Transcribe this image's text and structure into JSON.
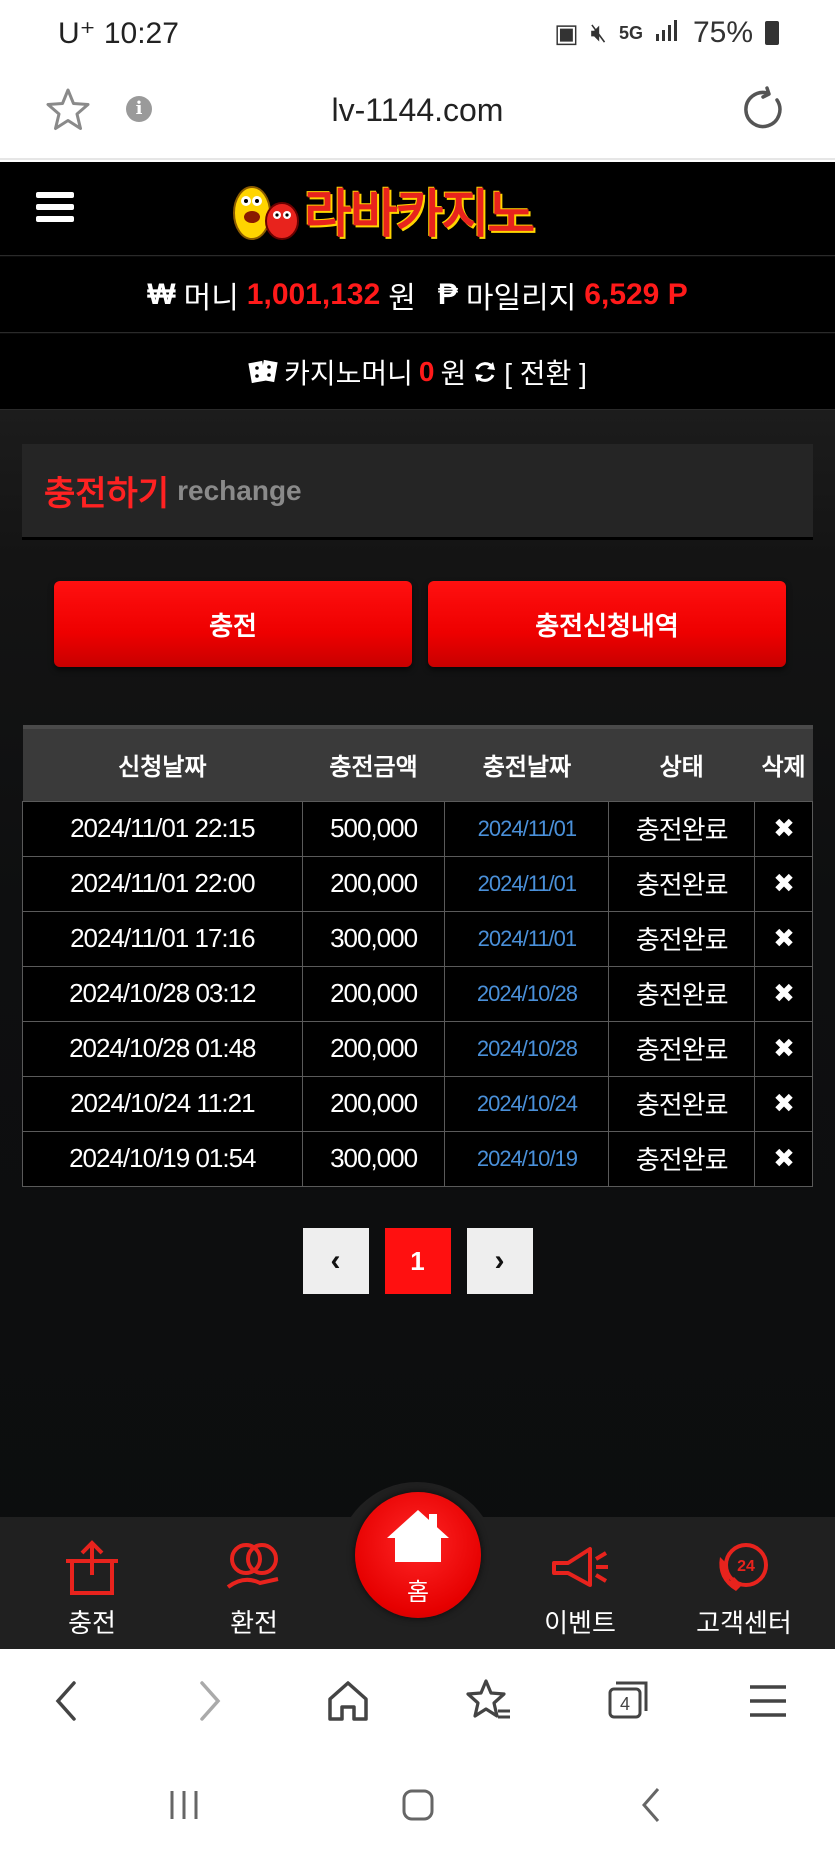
{
  "statusbar": {
    "carrier_time": "U⁺ 10:27",
    "battery": "75%",
    "network": "5G"
  },
  "browser": {
    "url": "lv-1144.com",
    "info_glyph": "i",
    "tabs_count": "4"
  },
  "site": {
    "logo_text": "라바카지노",
    "money": {
      "label": "머니",
      "won_symbol": "₩",
      "value": "1,001,132",
      "unit": "원",
      "mileage_symbol": "₱",
      "mileage_label": "마일리지",
      "mileage_value": "6,529 P"
    },
    "casino": {
      "label": "카지노머니",
      "value": "0",
      "unit": "원",
      "convert_label": "[ 전환 ]"
    },
    "panel": {
      "title_ko": "충전하기",
      "title_en": "rechange"
    },
    "buttons": {
      "charge": "충전",
      "history": "충전신청내역"
    },
    "table": {
      "headers": [
        "신청날짜",
        "충전금액",
        "충전날짜",
        "상태",
        "삭제"
      ],
      "rows": [
        [
          "2024/11/01 22:15",
          "500,000",
          "2024/11/01",
          "충전완료",
          "✖"
        ],
        [
          "2024/11/01 22:00",
          "200,000",
          "2024/11/01",
          "충전완료",
          "✖"
        ],
        [
          "2024/11/01 17:16",
          "300,000",
          "2024/11/01",
          "충전완료",
          "✖"
        ],
        [
          "2024/10/28 03:12",
          "200,000",
          "2024/10/28",
          "충전완료",
          "✖"
        ],
        [
          "2024/10/28 01:48",
          "200,000",
          "2024/10/28",
          "충전완료",
          "✖"
        ],
        [
          "2024/10/24 11:21",
          "200,000",
          "2024/10/24",
          "충전완료",
          "✖"
        ],
        [
          "2024/10/19 01:54",
          "300,000",
          "2024/10/19",
          "충전완료",
          "✖"
        ]
      ]
    },
    "pager": {
      "prev": "‹",
      "current": "1",
      "next": "›"
    },
    "bottom_nav": {
      "charge": "충전",
      "exchange": "환전",
      "home": "홈",
      "event": "이벤트",
      "support": "고객센터",
      "support_badge": "24"
    },
    "colors": {
      "accent_red": "#ff1010",
      "charge_date_blue": "#4a90d9",
      "mileage_gray": "#8a8a8a"
    }
  }
}
